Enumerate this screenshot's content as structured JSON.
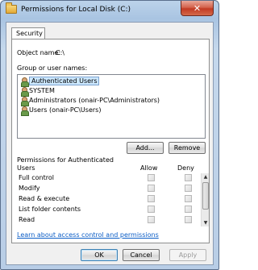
{
  "window": {
    "title": "Permissions for Local Disk (C:)",
    "close_glyph": "✕"
  },
  "tabs": [
    {
      "label": "Security"
    }
  ],
  "object": {
    "label": "Object name:",
    "value": "C:\\"
  },
  "group_label": "Group or user names:",
  "users": [
    {
      "name": "Authenticated Users",
      "icon": "group-icon",
      "selected": true
    },
    {
      "name": "SYSTEM",
      "icon": "group-icon",
      "selected": false
    },
    {
      "name": "Administrators (onair-PC\\Administrators)",
      "icon": "group-icon",
      "selected": false
    },
    {
      "name": "Users (onair-PC\\Users)",
      "icon": "group-icon",
      "selected": false
    }
  ],
  "buttons": {
    "add": "Add...",
    "remove": "Remove",
    "ok": "OK",
    "cancel": "Cancel",
    "apply": "Apply"
  },
  "permissions": {
    "label_line1": "Permissions for Authenticated",
    "label_line2": "Users",
    "col_allow": "Allow",
    "col_deny": "Deny",
    "rows": [
      {
        "name": "Full control",
        "allow": false,
        "deny": false
      },
      {
        "name": "Modify",
        "allow": false,
        "deny": false
      },
      {
        "name": "Read & execute",
        "allow": false,
        "deny": false
      },
      {
        "name": "List folder contents",
        "allow": false,
        "deny": false
      },
      {
        "name": "Read",
        "allow": false,
        "deny": false
      }
    ]
  },
  "link": "Learn about access control and permissions"
}
